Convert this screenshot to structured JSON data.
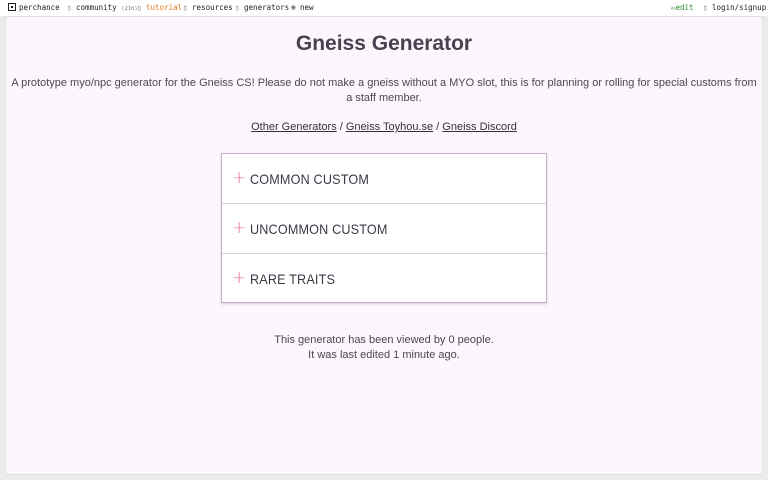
{
  "topbar": {
    "brand": "perchance",
    "community_label": "community",
    "community_count": "(21h)",
    "tutorial_label": "tutorial",
    "resources_label": "resources",
    "generators_label": "generators",
    "new_label": "new",
    "edit_label": "edit",
    "login_label": "login/signup"
  },
  "page": {
    "title": "Gneiss Generator",
    "description": "A prototype myo/npc generator for the Gneiss CS! Please do not make a gneiss without a MYO slot, this is for planning or rolling for special customs from a staff member.",
    "links": [
      {
        "label": "Other Generators"
      },
      {
        "label": "Gneiss Toyhou.se"
      },
      {
        "label": "Gneiss Discord"
      }
    ],
    "link_separator": " / "
  },
  "accordion": {
    "items": [
      {
        "label": "COMMON CUSTOM"
      },
      {
        "label": "UNCOMMON CUSTOM"
      },
      {
        "label": "RARE TRAITS"
      }
    ],
    "toggle_symbol": "+"
  },
  "footer": {
    "views_text": "This generator has been viewed by 0 people.",
    "edited_text": "It was last edited 1 minute ago."
  },
  "colors": {
    "accent_plus": "#e36f9d",
    "frame_bg": "#fcf6fd",
    "accordion_border": "#c9aed1",
    "tutorial": "#e07b1a",
    "edit": "#2a8a2a"
  }
}
